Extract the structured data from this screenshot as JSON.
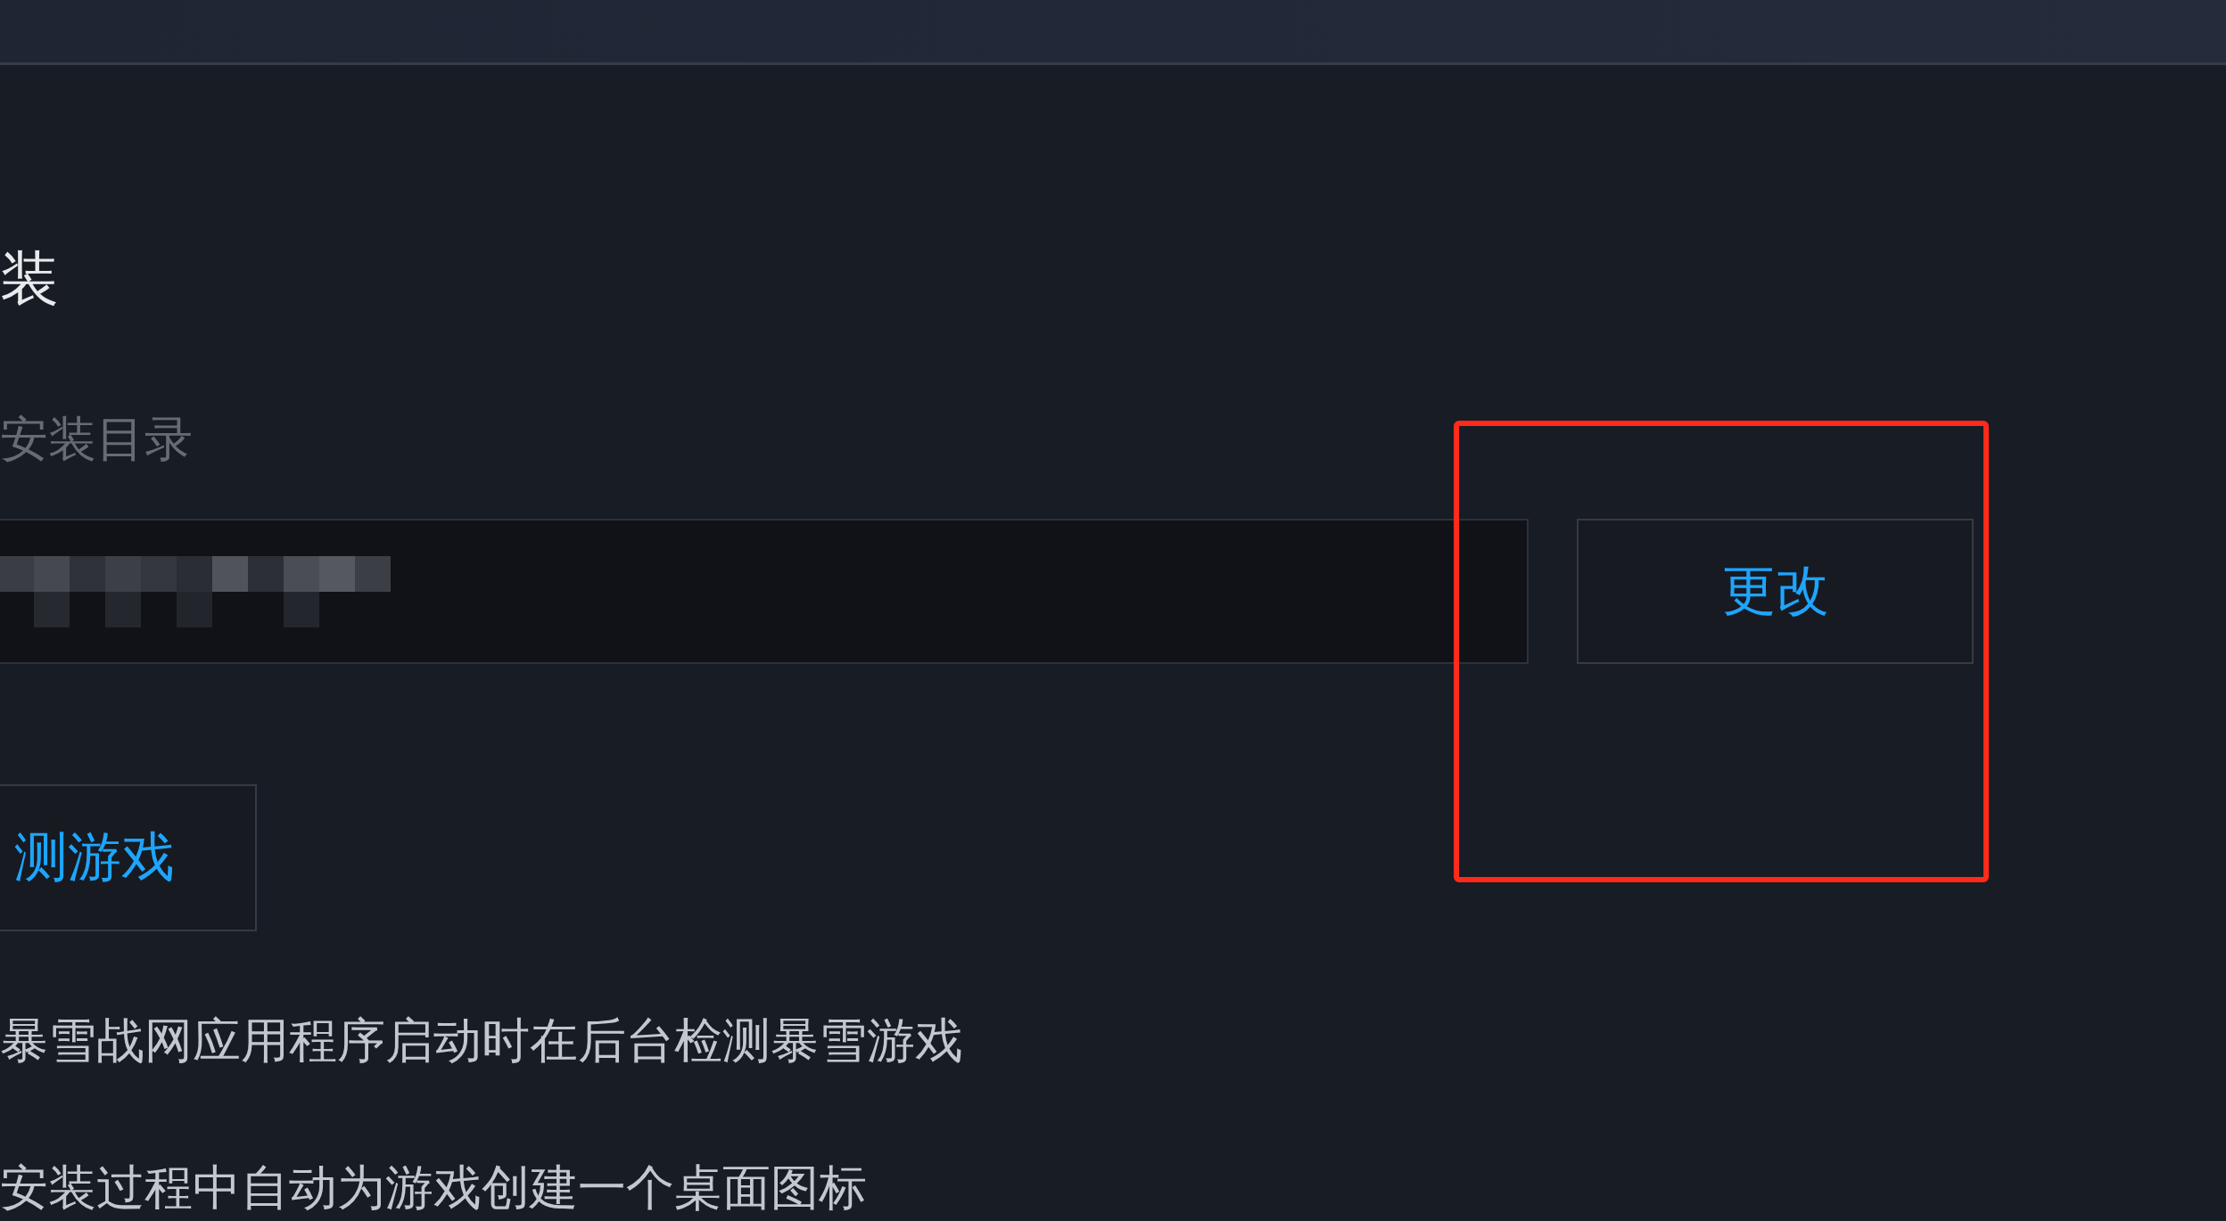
{
  "section": {
    "heading": "装"
  },
  "install_dir": {
    "label": "安装目录",
    "change_button": {
      "label": "更改",
      "highlighted": true
    }
  },
  "scan_button": {
    "label": "测游戏"
  },
  "options": [
    {
      "text": "暴雪战网应用程序启动时在后台检测暴雪游戏"
    },
    {
      "text": "安装过程中自动为游戏创建一个桌面图标"
    }
  ]
}
